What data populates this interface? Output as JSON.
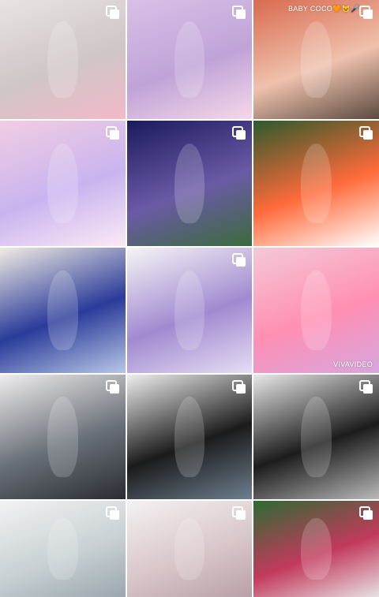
{
  "grid": {
    "rows": 5,
    "columns": 3,
    "icons": {
      "multi_post": "multiple-photos-icon"
    },
    "tiles": [
      {
        "id": "r1c1",
        "colors": [
          "#e9e3e3",
          "#cfc6c6",
          "#f3b9c9"
        ],
        "multi": true
      },
      {
        "id": "r1c2",
        "colors": [
          "#d8c1e8",
          "#bfa3d7",
          "#f6d7e9"
        ],
        "multi": true
      },
      {
        "id": "r1c3",
        "colors": [
          "#d96a4f",
          "#efc1ad",
          "#5b4a3f"
        ],
        "multi": true,
        "caption": "BABY COCO🧡🐱🎤"
      },
      {
        "id": "r2c1",
        "colors": [
          "#f2cde3",
          "#c9b4ef",
          "#fbe9f5"
        ],
        "multi": true
      },
      {
        "id": "r2c2",
        "colors": [
          "#1b1a5e",
          "#6b5aa6",
          "#3b6b3c"
        ],
        "multi": true
      },
      {
        "id": "r2c3",
        "colors": [
          "#2d5a2c",
          "#ff6a3a",
          "#ffffff"
        ],
        "multi": true
      },
      {
        "id": "r3c1",
        "colors": [
          "#f1ece3",
          "#2a3b9a",
          "#b8c7e6"
        ],
        "multi": false
      },
      {
        "id": "r3c2",
        "colors": [
          "#f7f4f6",
          "#a08ad0",
          "#e6ddf4"
        ],
        "multi": true
      },
      {
        "id": "r3c3",
        "colors": [
          "#f4c9d7",
          "#ff8fb3",
          "#d7a6df"
        ],
        "multi": false,
        "caption": "VIVAVIDEO"
      },
      {
        "id": "r4c1",
        "colors": [
          "#efedee",
          "#6a7078",
          "#2a2d33"
        ],
        "multi": true
      },
      {
        "id": "r4c2",
        "colors": [
          "#efefef",
          "#1b1b1b",
          "#6e7f8f"
        ],
        "multi": true
      },
      {
        "id": "r4c3",
        "colors": [
          "#e9e9e9",
          "#1c1c1c",
          "#b9b9b9"
        ],
        "multi": true
      },
      {
        "id": "r5c1",
        "colors": [
          "#f2f3f3",
          "#c9d1d4",
          "#9aa7ad"
        ],
        "multi": true
      },
      {
        "id": "r5c2",
        "colors": [
          "#f4f1f2",
          "#d9c7ca",
          "#b8a1a8"
        ],
        "multi": true
      },
      {
        "id": "r5c3",
        "colors": [
          "#2d6b33",
          "#c23a5c",
          "#e7e2e4"
        ],
        "multi": true
      }
    ]
  }
}
